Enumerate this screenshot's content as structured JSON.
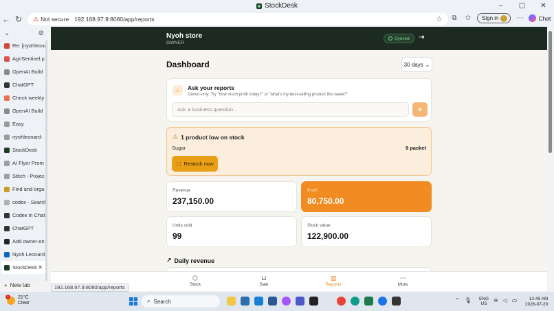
{
  "window": {
    "title": "StockDesk",
    "minimize": "–",
    "maximize": "▢",
    "close": "✕"
  },
  "address": {
    "security": "Not secure",
    "url": "192.168.97.9:8080/app/reports",
    "signin": "Sign in",
    "chat": "Chat"
  },
  "tabs": {
    "items": [
      {
        "label": "Re: [nyohleona",
        "color": "#d44638"
      },
      {
        "label": "AgriSentinel.p",
        "color": "#d9534f"
      },
      {
        "label": "OpenAI Build",
        "color": "#8a8a8a"
      },
      {
        "label": "ChatGPT",
        "color": "#333333"
      },
      {
        "label": "Check weekly",
        "color": "#e9724c"
      },
      {
        "label": "OpenAI Build",
        "color": "#8a8a8a"
      },
      {
        "label": "Easy",
        "color": "#9a9a9a"
      },
      {
        "label": "nyohleonard-",
        "color": "#9a9a9a"
      },
      {
        "label": "StockDesk",
        "color": "#1b3a24"
      },
      {
        "label": "AI Flyer Prom",
        "color": "#9aa0a6"
      },
      {
        "label": "Stitch - Projec",
        "color": "#9aa0a6"
      },
      {
        "label": "Find and orga",
        "color": "#c89b2b"
      },
      {
        "label": "codex - Search",
        "color": "#b0b0b0"
      },
      {
        "label": "Codex in Chat",
        "color": "#333333"
      },
      {
        "label": "ChatGPT",
        "color": "#333333"
      },
      {
        "label": "Add owner-on",
        "color": "#222222"
      },
      {
        "label": "Nyoh Leonard",
        "color": "#0a66c2"
      },
      {
        "label": "StockDesk",
        "color": "#1b3a24"
      }
    ],
    "new_tab": "New tab"
  },
  "header": {
    "store_name": "Nyoh store",
    "role": "OWNER",
    "sync_status": "Synced"
  },
  "dashboard": {
    "title": "Dashboard",
    "range": "30 days"
  },
  "ask": {
    "title": "Ask your reports",
    "subtitle": "Owner-only. Try \"how much profit today?\" or \"what's my best-selling product this week?\"",
    "placeholder": "Ask a business question..."
  },
  "alert": {
    "title": "1 product low on stock",
    "item": "Sugar",
    "qty": "9 packet",
    "button": "Restock now"
  },
  "stats": {
    "revenue": {
      "label": "Revenue",
      "value": "237,150.00"
    },
    "profit": {
      "label": "Profit",
      "value": "80,750.00"
    },
    "units": {
      "label": "Units sold",
      "value": "99"
    },
    "stock": {
      "label": "Stock value",
      "value": "122,900.00"
    }
  },
  "daily": {
    "title": "Daily revenue"
  },
  "nav": {
    "stock": "Stock",
    "sale": "Sale",
    "reports": "Reports",
    "more": "More"
  },
  "status_url": "192.168.97.9:8080/app/reports",
  "taskbar": {
    "temp": "21°C",
    "weather": "Clear",
    "badge": "1",
    "search": "Search",
    "lang1": "ENG",
    "lang2": "US",
    "time": "12:49 AM",
    "date": "2026-07-20"
  },
  "colors": {
    "accent": "#f18c23",
    "header": "#1c2a21",
    "alert_bg": "#fbeedd",
    "button": "#eaa016"
  }
}
